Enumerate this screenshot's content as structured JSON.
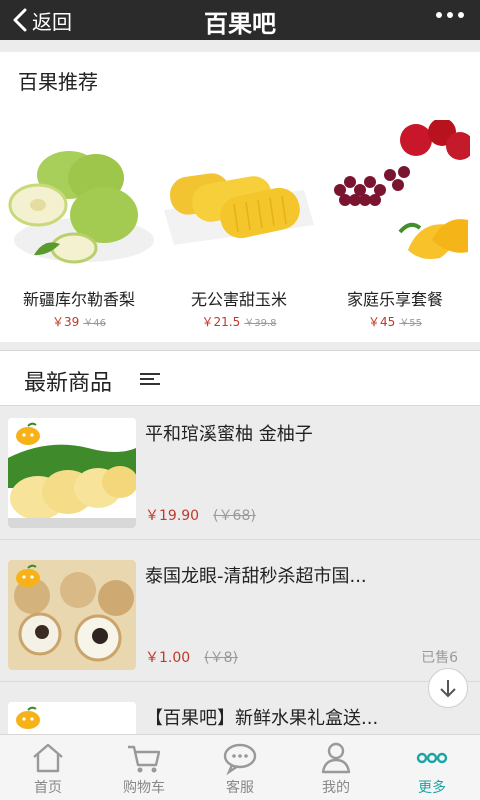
{
  "topbar": {
    "back_label": "返回",
    "title": "百果吧"
  },
  "recommend": {
    "title": "百果推荐",
    "items": [
      {
        "name": "新疆库尔勒香梨",
        "price": "￥39",
        "old_price": "￥46"
      },
      {
        "name": "无公害甜玉米",
        "price": "￥21.5",
        "old_price": "￥39.8"
      },
      {
        "name": "家庭乐享套餐",
        "price": "￥45",
        "old_price": "￥55"
      }
    ]
  },
  "latest": {
    "title": "最新商品"
  },
  "products": [
    {
      "name": "平和琯溪蜜柚 金柚子",
      "price": "￥19.90",
      "old_price": "(￥68)",
      "sold": ""
    },
    {
      "name": "泰国龙眼-清甜秒杀超市国...",
      "price": "￥1.00",
      "old_price": "(￥8)",
      "sold": "已售6"
    },
    {
      "name": "【百果吧】新鲜水果礼盒送...",
      "price": "",
      "old_price": "",
      "sold": ""
    }
  ],
  "nav": [
    {
      "label": "首页",
      "icon": "home-icon"
    },
    {
      "label": "购物车",
      "icon": "cart-icon"
    },
    {
      "label": "客服",
      "icon": "chat-icon"
    },
    {
      "label": "我的",
      "icon": "user-icon"
    },
    {
      "label": "更多",
      "icon": "more-dots-icon"
    }
  ],
  "colors": {
    "accent": "#1aa5a5",
    "price": "#c0392b",
    "topbar": "#2b2b2b"
  }
}
